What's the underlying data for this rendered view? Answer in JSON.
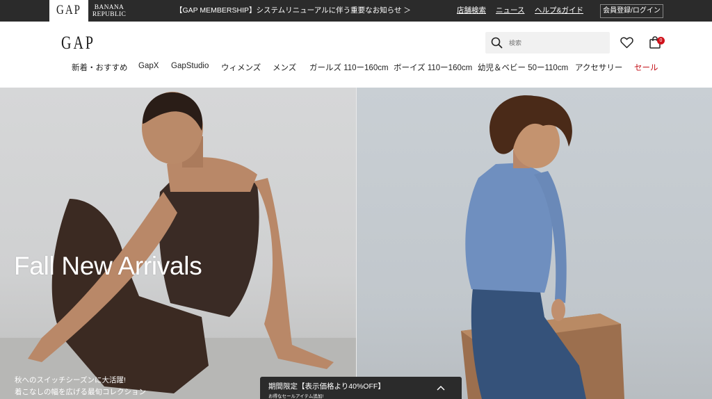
{
  "topbar": {
    "brand_gap": "GAP",
    "brand_banana": "BANANA",
    "brand_republic": "REPUBLIC",
    "announcement": "【GAP MEMBERSHIP】システムリニューアルに伴う重要なお知らせ ＞",
    "links": {
      "store": "店舗検索",
      "news": "ニュース",
      "help": "ヘルプ&ガイド"
    },
    "login": "会員登録/ログイン"
  },
  "header": {
    "logo": "GAP",
    "search_placeholder": "検索",
    "bag_count": "0",
    "icons": [
      "search-icon",
      "heart-icon",
      "bag-icon"
    ]
  },
  "nav": {
    "new": "新着・おすすめ",
    "gapx": "GapX",
    "gapstudio": "GapStudio",
    "womens": "ウィメンズ",
    "mens": "メンズ",
    "girls": "ガールズ 110ー160cm",
    "boys": "ボーイズ 110ー160cm",
    "baby": "幼児＆ベビー 50ー110cm",
    "accessories": "アクセサリー",
    "sale": "セール"
  },
  "hero": {
    "title": "Fall New Arrivals",
    "sub1": "秋へのスイッチシーズンに大活躍!",
    "sub2": "着こなしの幅を広げる最旬コレクション"
  },
  "promo": {
    "title": "期間限定【表示価格より40%OFF】",
    "subtitle": "お得なセールアイテム追加!"
  },
  "colors": {
    "topbar": "#2b2b2b",
    "sale": "#c4121a",
    "badge": "#d0121b"
  }
}
